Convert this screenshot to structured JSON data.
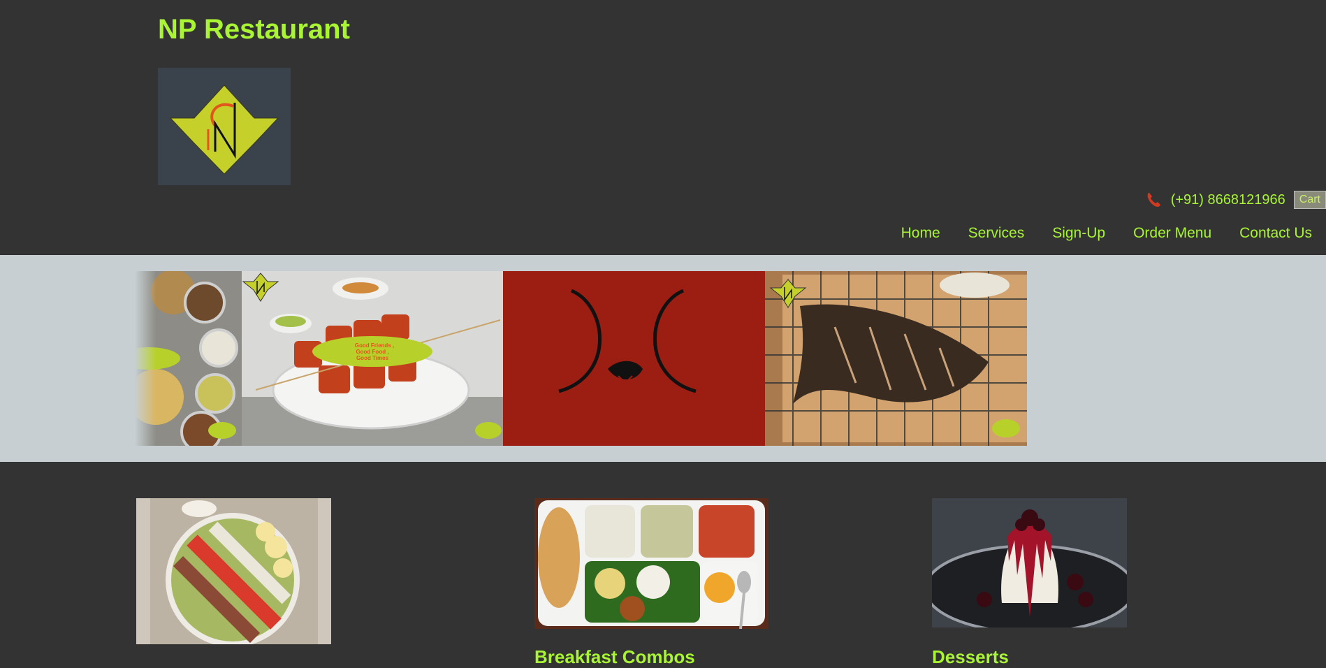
{
  "header": {
    "title": "NP Restaurant",
    "phone": "(+91) 8668121966",
    "cart_label": "Cart"
  },
  "nav": {
    "items": [
      "Home",
      "Services",
      "Sign-Up",
      "Order Menu",
      "Contact Us"
    ]
  },
  "slider": {
    "slide2_caption_lines": [
      "Good Friends ,",
      "Good Food ,",
      "Good Times"
    ]
  },
  "cards": [
    {
      "title": ""
    },
    {
      "title": "Breakfast Combos"
    },
    {
      "title": "Desserts"
    }
  ],
  "colors": {
    "accent": "#a9f534",
    "background": "#333333",
    "slider_band": "#c7cfd2",
    "red_slide": "#9c1e12",
    "logo_bg": "#3a424c",
    "logo_yellow": "#c5d12a"
  }
}
